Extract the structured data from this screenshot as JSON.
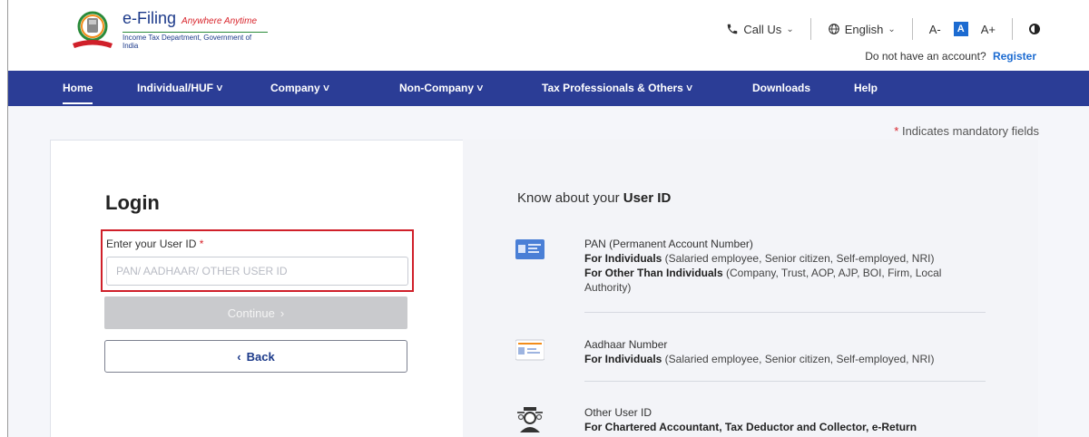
{
  "header": {
    "brand": "e-Filing",
    "tagline": "Anywhere Anytime",
    "subtitle": "Income Tax Department, Government of India",
    "call_us": "Call Us",
    "language": "English",
    "font_decrease": "A-",
    "font_normal": "A",
    "font_increase": "A+",
    "no_account_text": "Do not have an account?",
    "register_link": "Register"
  },
  "nav": {
    "items": [
      {
        "label": "Home"
      },
      {
        "label": "Individual/HUF ˅"
      },
      {
        "label": "Company ˅"
      },
      {
        "label": "Non-Company ˅"
      },
      {
        "label": "Tax Professionals & Others ˅"
      },
      {
        "label": "Downloads"
      },
      {
        "label": "Help"
      }
    ]
  },
  "main": {
    "mandatory_star": "*",
    "mandatory_note": "Indicates mandatory fields",
    "login": {
      "title": "Login",
      "user_id_label": "Enter your User ID",
      "required_star": "*",
      "user_id_placeholder": "PAN/ AADHAAR/ OTHER USER ID",
      "user_id_value": "",
      "continue_label": "Continue",
      "continue_arrow": "›",
      "back_arrow": "‹",
      "back_label": "Back"
    },
    "know": {
      "prefix": "Know about your",
      "strong": "User ID",
      "items": [
        {
          "icon": "pan-card-icon",
          "title": "PAN (Permanent Account Number)",
          "line1_bold": "For Individuals",
          "line1_rest": " (Salaried employee, Senior citizen, Self-employed, NRI)",
          "line2_bold": "For Other Than Individuals",
          "line2_rest": " (Company, Trust, AOP, AJP, BOI, Firm, Local Authority)"
        },
        {
          "icon": "aadhaar-card-icon",
          "title": "Aadhaar Number",
          "line1_bold": "For Individuals",
          "line1_rest": " (Salaried employee, Senior citizen, Self-employed, NRI)"
        },
        {
          "icon": "professional-user-icon",
          "title": "Other User ID",
          "line1_bold": "For Chartered Accountant, Tax Deductor and Collector, e-Return",
          "line1_rest": ""
        }
      ]
    }
  },
  "colors": {
    "nav_bg": "#2b3d96",
    "brand_blue": "#1c3a8a",
    "accent_red": "#d0202a",
    "link_blue": "#1c6bd1"
  }
}
